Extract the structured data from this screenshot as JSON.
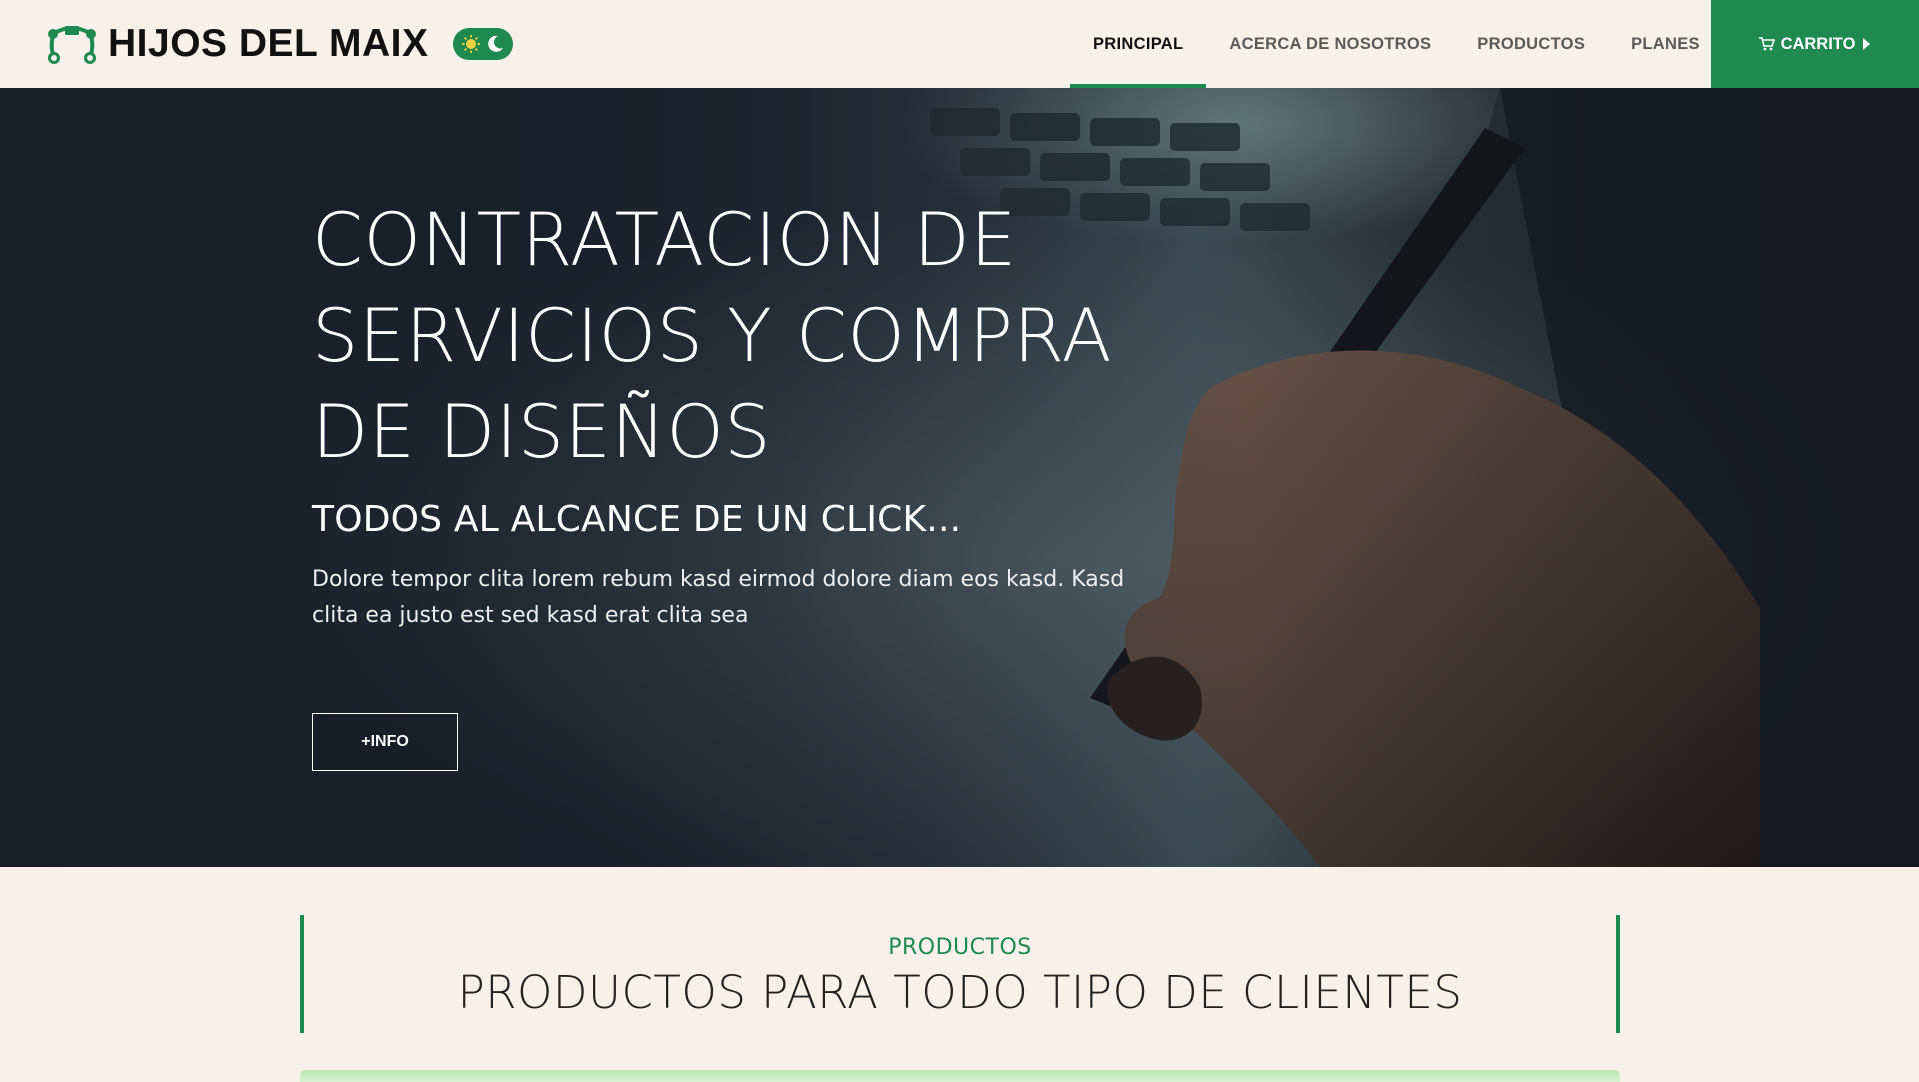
{
  "brand": {
    "name": "HIJOS DEL MAIX",
    "logo_icon": "vector-pen-icon",
    "color": "#1e8a4f"
  },
  "theme_toggle": {
    "icons": [
      "sun-icon",
      "moon-icon"
    ]
  },
  "nav": {
    "links": [
      {
        "label": "PRINCIPAL",
        "active": true
      },
      {
        "label": "ACERCA DE NOSOTROS",
        "active": false
      },
      {
        "label": "PRODUCTOS",
        "active": false
      },
      {
        "label": "PLANES",
        "active": false
      }
    ],
    "cart_label": "CARRITO",
    "cart_icon": "cart-icon",
    "accent": "#1e8a4f"
  },
  "hero": {
    "title": "CONTRATACION DE SERVICIOS Y COMPRA DE DISEÑOS",
    "subtitle": "TODOS AL ALCANCE DE UN CLICK...",
    "text": "Dolore tempor clita lorem rebum kasd eirmod dolore diam eos kasd. Kasd clita ea justo est sed kasd erat clita sea",
    "button_label": "+INFO"
  },
  "section": {
    "eyebrow": "PRODUCTOS",
    "title": "PRODUCTOS PARA TODO TIPO DE CLIENTES"
  }
}
